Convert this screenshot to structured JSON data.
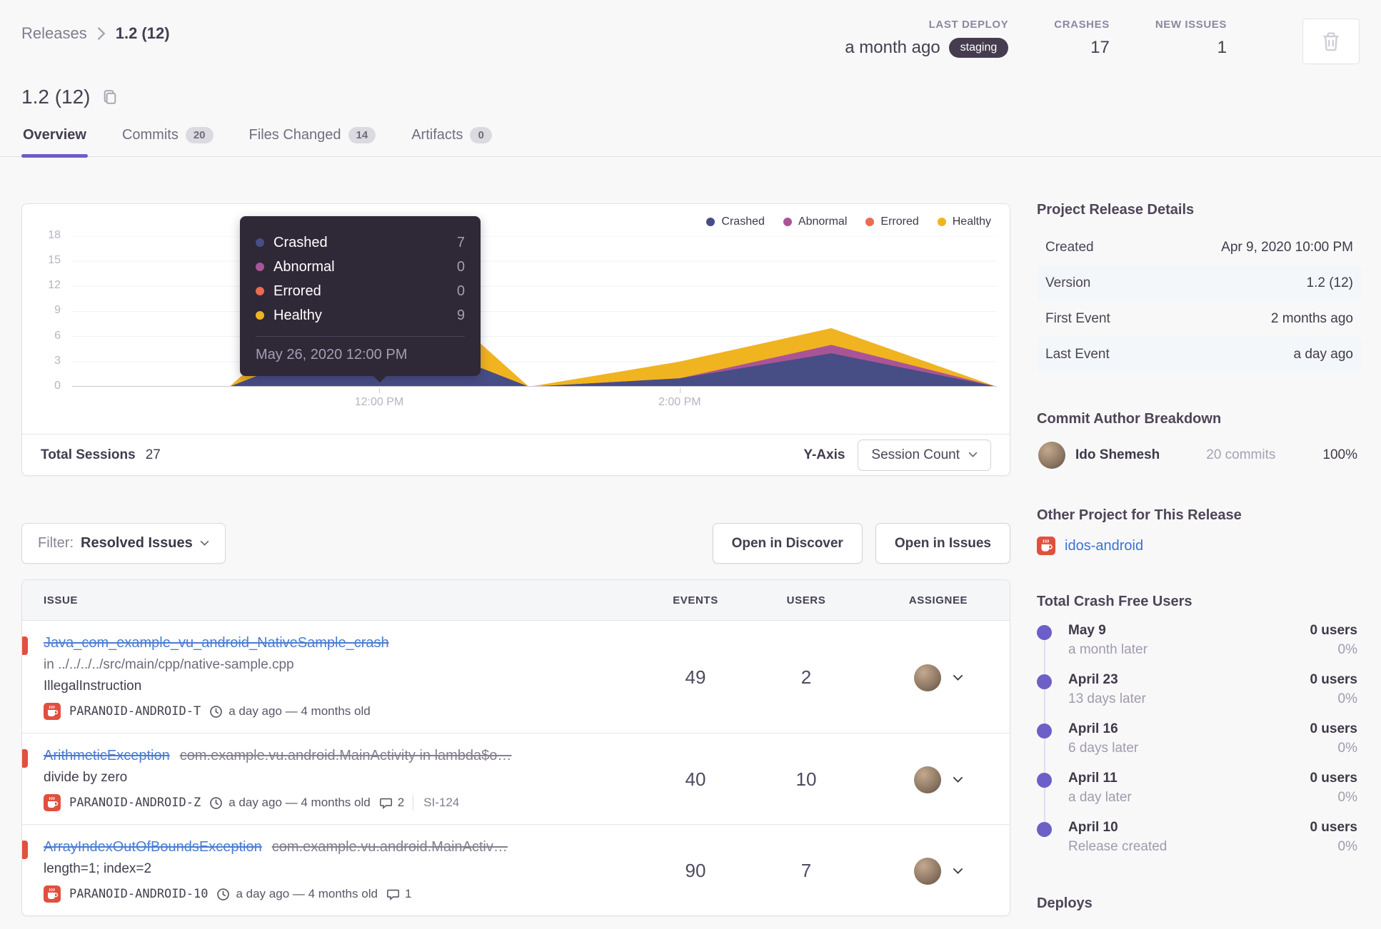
{
  "breadcrumb": {
    "root": "Releases",
    "current": "1.2 (12)"
  },
  "header_stats": {
    "last_deploy": {
      "label": "LAST DEPLOY",
      "value": "a month ago",
      "badge": "staging"
    },
    "crashes": {
      "label": "CRASHES",
      "value": "17"
    },
    "new_issues": {
      "label": "NEW ISSUES",
      "value": "1"
    }
  },
  "title": "1.2 (12)",
  "tabs": [
    {
      "label": "Overview",
      "badge": ""
    },
    {
      "label": "Commits",
      "badge": "20"
    },
    {
      "label": "Files Changed",
      "badge": "14"
    },
    {
      "label": "Artifacts",
      "badge": "0"
    }
  ],
  "chart": {
    "tooltip": {
      "rows": [
        {
          "label": "Crashed",
          "value": "7"
        },
        {
          "label": "Abnormal",
          "value": "0"
        },
        {
          "label": "Errored",
          "value": "0"
        },
        {
          "label": "Healthy",
          "value": "9"
        }
      ],
      "date": "May 26, 2020 12:00 PM"
    },
    "footer": {
      "total_label": "Total Sessions",
      "total_value": "27",
      "yaxis_label": "Y-Axis",
      "yaxis_value": "Session Count"
    }
  },
  "chart_data": {
    "type": "area",
    "stacked": true,
    "x": [
      "10:00 AM",
      "11:00 AM",
      "12:00 PM",
      "1:00 PM",
      "2:00 PM",
      "3:10 PM",
      "4:10 PM"
    ],
    "x_frac": [
      0,
      0.17,
      0.332,
      0.494,
      0.657,
      0.821,
      1
    ],
    "series": [
      {
        "name": "Crashed",
        "color": "#474d85",
        "values": [
          0,
          0,
          7,
          0,
          1,
          4,
          0
        ]
      },
      {
        "name": "Abnormal",
        "color": "#aa5498",
        "values": [
          0,
          0,
          0,
          0,
          0,
          1,
          0
        ]
      },
      {
        "name": "Errored",
        "color": "#ee6a51",
        "values": [
          0,
          0,
          0,
          0,
          0,
          0,
          0
        ]
      },
      {
        "name": "Healthy",
        "color": "#f0b421",
        "values": [
          0,
          0,
          9,
          0,
          2,
          2,
          0
        ]
      }
    ],
    "ylim": [
      0,
      18
    ],
    "y_ticks": [
      "18",
      "15",
      "12",
      "9",
      "6",
      "3",
      "0"
    ],
    "x_ticks": [
      {
        "label": "12:00 PM",
        "frac": 0.332
      },
      {
        "label": "2:00 PM",
        "frac": 0.657
      }
    ],
    "grid": true,
    "legend_position": "top-right",
    "total_sessions": 27
  },
  "filter": {
    "prefix": "Filter:",
    "value": "Resolved Issues"
  },
  "actions": {
    "discover": "Open in Discover",
    "issues": "Open in Issues"
  },
  "issues_table": {
    "columns": {
      "issue": "ISSUE",
      "events": "EVENTS",
      "users": "USERS",
      "assignee": "ASSIGNEE"
    },
    "rows": [
      {
        "title": "Java_com_example_vu_android_NativeSample_crash",
        "culprit": "",
        "path": "in ../../../../src/main/cpp/native-sample.cpp",
        "message": "IllegalInstruction",
        "project": "PARANOID-ANDROID-T",
        "age": "a day ago — 4 months old",
        "comments": "",
        "short_id": "",
        "events": "49",
        "users": "2"
      },
      {
        "title": "ArithmeticException",
        "culprit": "com.example.vu.android.MainActivity in lambda$o…",
        "path": "",
        "message": "divide by zero",
        "project": "PARANOID-ANDROID-Z",
        "age": "a day ago — 4 months old",
        "comments": "2",
        "short_id": "SI-124",
        "events": "40",
        "users": "10"
      },
      {
        "title": "ArrayIndexOutOfBoundsException",
        "culprit": "com.example.vu.android.MainActiv…",
        "path": "",
        "message": "length=1; index=2",
        "project": "PARANOID-ANDROID-10",
        "age": "a day ago — 4 months old",
        "comments": "1",
        "short_id": "",
        "events": "90",
        "users": "7"
      }
    ]
  },
  "sidebar": {
    "release_details": {
      "heading": "Project Release Details",
      "rows": [
        {
          "label": "Created",
          "value": "Apr 9, 2020 10:00 PM"
        },
        {
          "label": "Version",
          "value": "1.2 (12)"
        },
        {
          "label": "First Event",
          "value": "2 months ago"
        },
        {
          "label": "Last Event",
          "value": "a day ago"
        }
      ]
    },
    "commit_authors": {
      "heading": "Commit Author Breakdown",
      "entries": [
        {
          "name": "Ido Shemesh",
          "commits": "20 commits",
          "percent": "100%"
        }
      ]
    },
    "other_project": {
      "heading": "Other Project for This Release",
      "link": "idos-android"
    },
    "crash_free": {
      "heading": "Total Crash Free Users",
      "entries": [
        {
          "date": "May 9",
          "when": "a month later",
          "users": "0 users",
          "percent": "0%"
        },
        {
          "date": "April 23",
          "when": "13 days later",
          "users": "0 users",
          "percent": "0%"
        },
        {
          "date": "April 16",
          "when": "6 days later",
          "users": "0 users",
          "percent": "0%"
        },
        {
          "date": "April 11",
          "when": "a day later",
          "users": "0 users",
          "percent": "0%"
        },
        {
          "date": "April 10",
          "when": "Release created",
          "users": "0 users",
          "percent": "0%"
        }
      ]
    },
    "deploys_heading": "Deploys"
  }
}
